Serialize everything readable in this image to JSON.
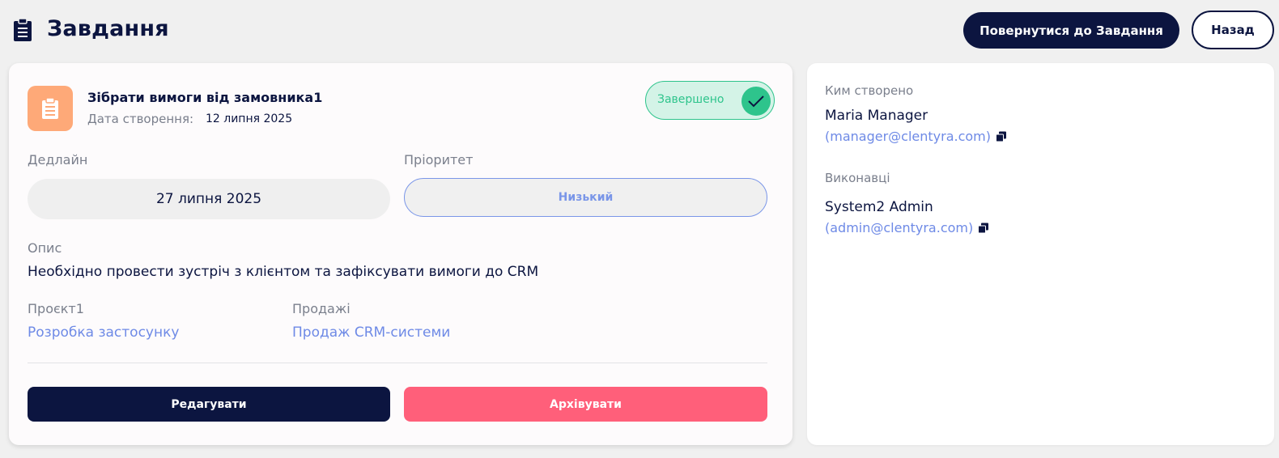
{
  "header": {
    "title": "Завдання",
    "return_button": "Повернутися до Завдання",
    "back_button": "Назад"
  },
  "task": {
    "title": "Зібрати вимоги від замовника1",
    "created_label": "Дата створення:",
    "created_value": "12 липня 2025",
    "status_label": "Завершено",
    "status_completed": true,
    "icon": "clipboard-icon",
    "icon_color": "#fea978"
  },
  "fields": {
    "deadline_label": "Дедлайн",
    "deadline_value": "27 липня 2025",
    "priority_label": "Пріоритет",
    "priority_value": "Низький",
    "description_label": "Опис",
    "description_value": "Необхідно провести зустріч з клієнтом та зафіксувати вимоги до CRM",
    "project_label": "Проєкт1",
    "project_value": "Розробка застосунку",
    "sales_label": "Продажі",
    "sales_value": "Продаж CRM-системи"
  },
  "actions": {
    "edit_button": "Редагувати",
    "archive_button": "Архівувати"
  },
  "side": {
    "created_by_label": "Ким створено",
    "created_by_name": "Maria Manager",
    "created_by_email": "(manager@clentyra.com)",
    "assignees_label": "Виконавці",
    "assignee_name": "System2 Admin",
    "assignee_email": "(admin@clentyra.com)"
  },
  "colors": {
    "primary": "#0c1540",
    "accent": "#6e8ae6",
    "success": "#2ec48c",
    "danger": "#ff5f7a",
    "muted": "#7a7f8c"
  }
}
